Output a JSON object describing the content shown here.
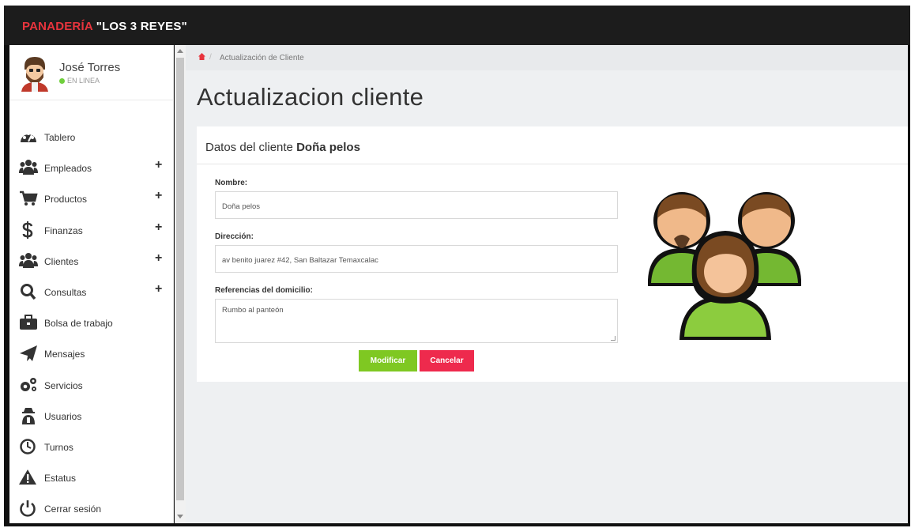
{
  "brand": {
    "part1": "PANADERÍA",
    "part2": "\"LOS 3 REYES\""
  },
  "user": {
    "name": "José Torres",
    "status": "EN LINEA"
  },
  "menu": [
    {
      "label": "Tablero",
      "icon": "tachometer-icon",
      "expandable": false
    },
    {
      "label": "Empleados",
      "icon": "users-icon",
      "expandable": true
    },
    {
      "label": "Productos",
      "icon": "cart-icon",
      "expandable": true
    },
    {
      "label": "Finanzas",
      "icon": "dollar-icon",
      "expandable": true
    },
    {
      "label": "Clientes",
      "icon": "users-icon",
      "expandable": true
    },
    {
      "label": "Consultas",
      "icon": "search-icon",
      "expandable": true
    },
    {
      "label": "Bolsa de trabajo",
      "icon": "briefcase-icon",
      "expandable": false
    },
    {
      "label": "Mensajes",
      "icon": "paper-plane-icon",
      "expandable": false
    },
    {
      "label": "Servicios",
      "icon": "cogs-icon",
      "expandable": false
    },
    {
      "label": "Usuarios",
      "icon": "user-secret-icon",
      "expandable": false
    },
    {
      "label": "Turnos",
      "icon": "clock-icon",
      "expandable": false
    },
    {
      "label": "Estatus",
      "icon": "warning-icon",
      "expandable": false
    },
    {
      "label": "Cerrar sesión",
      "icon": "power-icon",
      "expandable": false
    }
  ],
  "plus_glyph": "+",
  "breadcrumb": {
    "sep": "/",
    "current": "Actualización de Cliente"
  },
  "page_title": "Actualizacion cliente",
  "panel": {
    "title_prefix": "Datos del cliente",
    "title_name": "Doña pelos"
  },
  "form": {
    "nombre_label": "Nombre:",
    "nombre_value": "Doña pelos",
    "direccion_label": "Dirección:",
    "direccion_value": "av benito juarez #42, San Baltazar Temaxcalac",
    "referencias_label": "Referencias del domicilio:",
    "referencias_value": "Rumbo al panteón"
  },
  "buttons": {
    "modify": "Modificar",
    "cancel": "Cancelar"
  },
  "colors": {
    "brand_red": "#e8343d",
    "topbar": "#1c1c1c",
    "modify_green": "#7fc822",
    "cancel_red": "#ee2a4d",
    "online_green": "#6fcf3c"
  },
  "illustration": "clients-group-icon"
}
